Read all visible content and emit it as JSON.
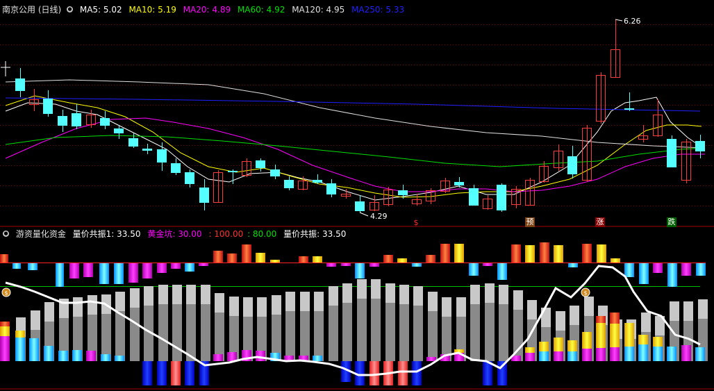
{
  "upper": {
    "title": "南京公用 (日线)",
    "legend": [
      {
        "text": "MA5: 5.02",
        "color": "#ffffff"
      },
      {
        "text": "MA10: 5.19",
        "color": "#ffff00"
      },
      {
        "text": "MA20: 4.89",
        "color": "#ff00ff"
      },
      {
        "text": "MA60: 4.92",
        "color": "#00e000"
      },
      {
        "text": "MA120: 4.95",
        "color": "#e0e0e0"
      },
      {
        "text": "MA250: 5.33",
        "color": "#2020ff"
      }
    ],
    "high_label": "6.26",
    "low_label": "4.29",
    "signals": [
      {
        "text": "$",
        "color": "#ff3030"
      },
      {
        "text": "预",
        "color": "#ffffff",
        "bg": "#7a4010"
      },
      {
        "text": "涨",
        "color": "#ffffff",
        "bg": "#8a0000"
      },
      {
        "text": "跌",
        "color": "#ffffff",
        "bg": "#006000"
      }
    ]
  },
  "lower": {
    "title": "游资量化资金",
    "legend": [
      {
        "text": "量价共振1: 33.50",
        "color": "#ffffff"
      },
      {
        "text": "黄金坑: 30.00",
        "color": "#ff00ff"
      },
      {
        "text": ": 100.00",
        "color": "#ff3030"
      },
      {
        "text": ": 80.00",
        "color": "#00e000"
      },
      {
        "text": "量价共振: 33.50",
        "color": "#ffffff"
      }
    ]
  },
  "colors": {
    "up": "#ff3a3a",
    "down": "#54ffff",
    "grid": "#8b0000"
  }
}
